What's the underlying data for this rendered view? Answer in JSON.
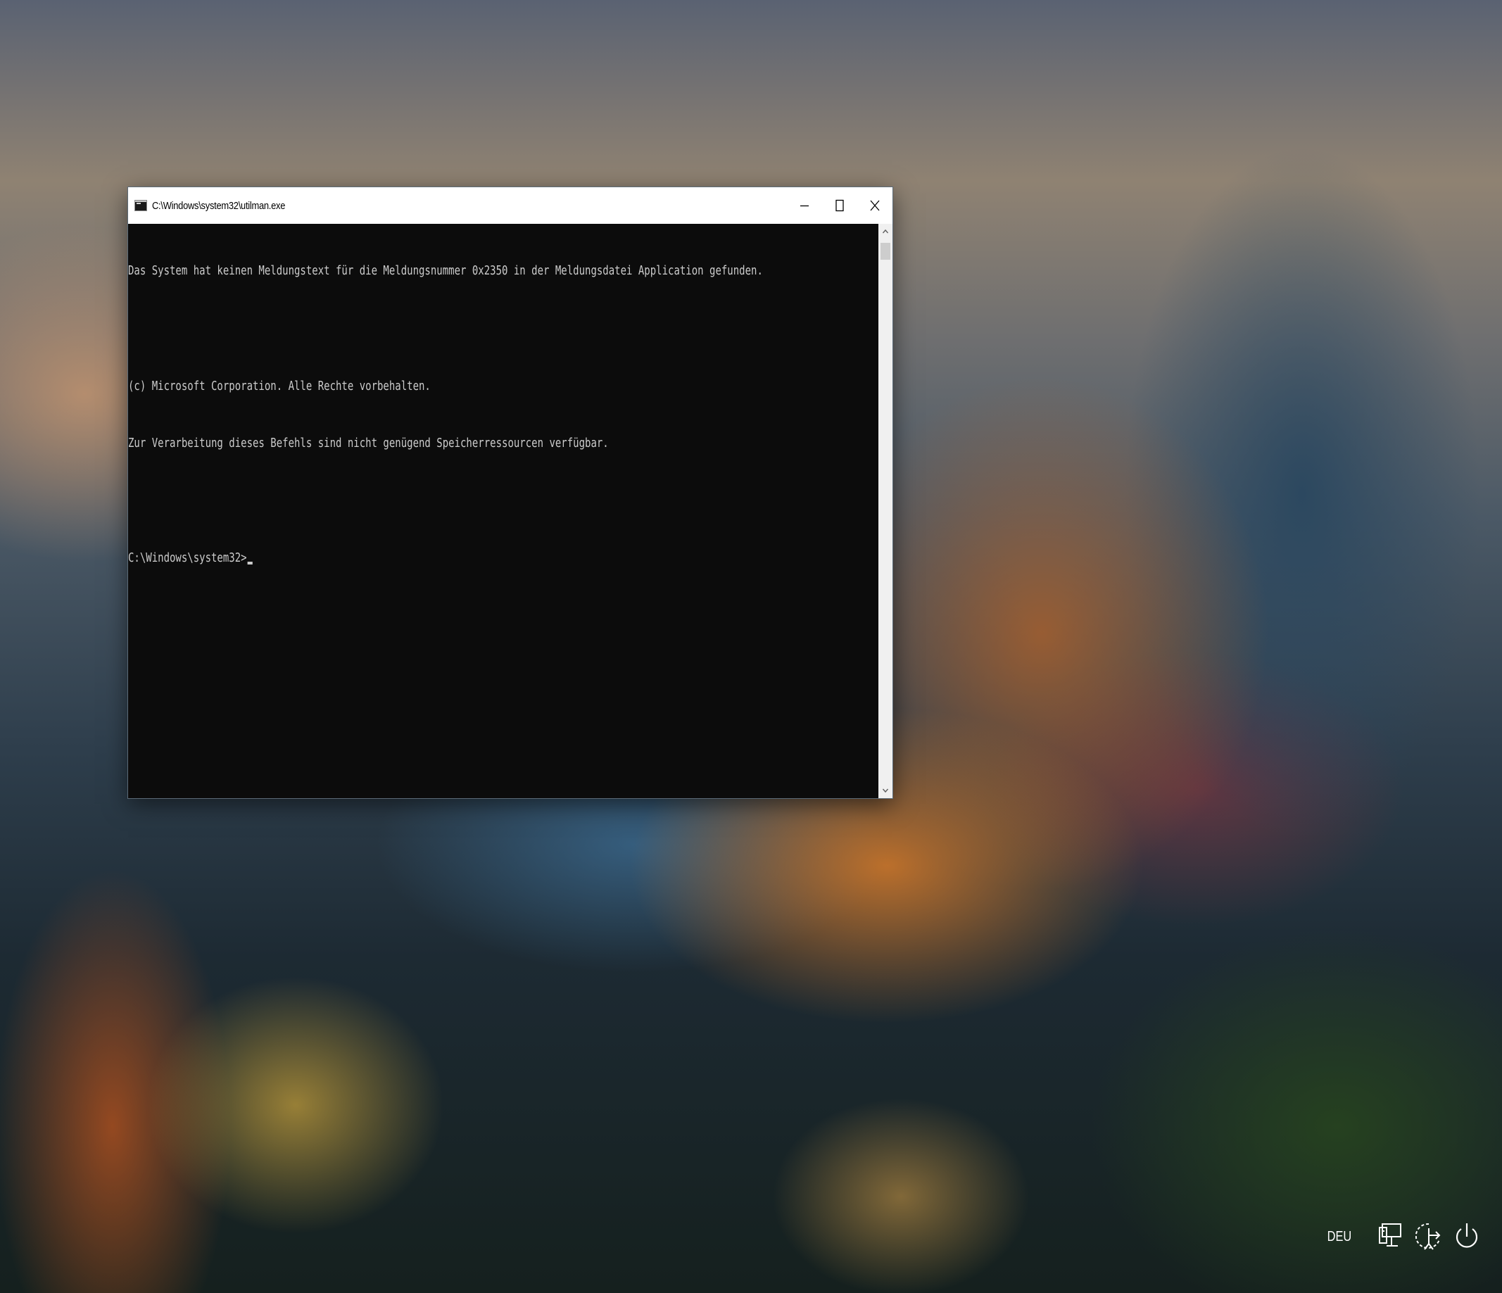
{
  "window": {
    "title": "C:\\Windows\\system32\\utilman.exe",
    "icon": "console-app-icon",
    "buttons": {
      "minimize": "minimize-icon",
      "maximize": "maximize-icon",
      "close": "close-icon"
    }
  },
  "console": {
    "lines": [
      "Das System hat keinen Meldungstext für die Meldungsnummer 0x2350 in der Meldungsdatei Application gefunden.",
      "",
      "(c) Microsoft Corporation. Alle Rechte vorbehalten.",
      "Zur Verarbeitung dieses Befehls sind nicht genügend Speicherressourcen verfügbar.",
      "",
      "C:\\Windows\\system32>"
    ],
    "text_color": "#cccccc",
    "background_color": "#0c0c0c"
  },
  "tray": {
    "language": "DEU",
    "icons": [
      "network-icon",
      "accessibility-icon",
      "power-icon"
    ]
  }
}
